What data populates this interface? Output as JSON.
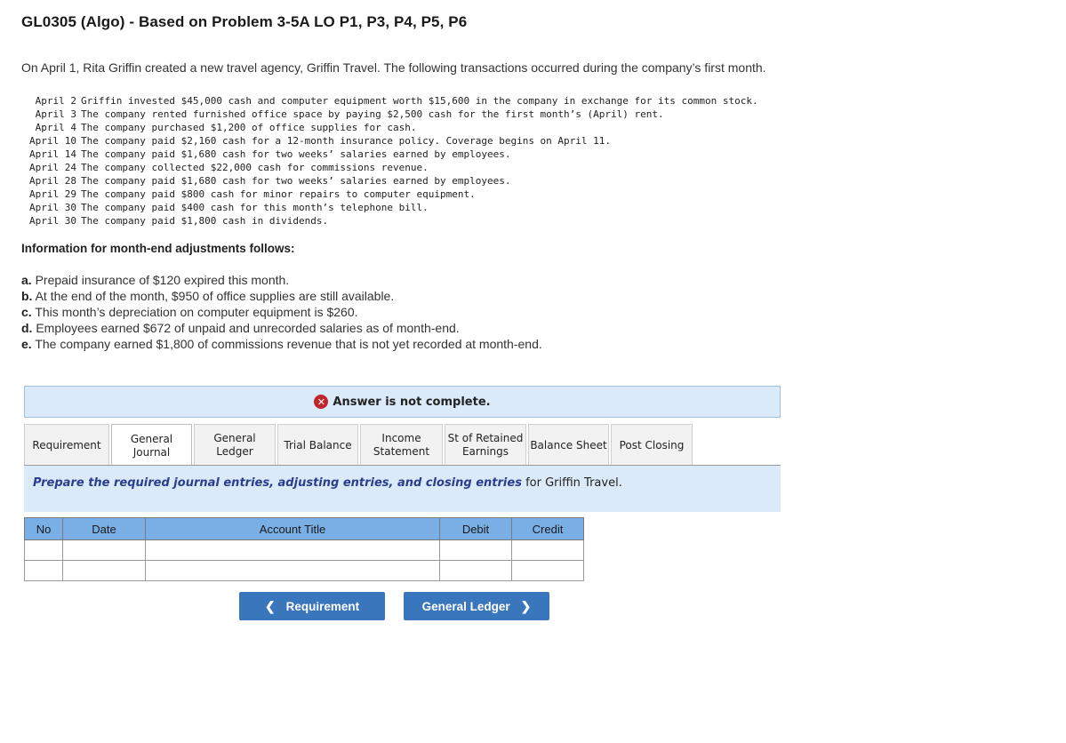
{
  "title": "GL0305 (Algo) - Based on Problem 3-5A LO P1, P3, P4, P5, P6",
  "intro": "On April 1, Rita Griffin created a new travel agency, Griffin Travel. The following transactions occurred during the company’s first month.",
  "transactions": [
    {
      "date": "April 2",
      "text": "Griffin invested $45,000 cash and computer equipment worth $15,600 in the company in exchange for its common stock."
    },
    {
      "date": "April 3",
      "text": "The company rented furnished office space by paying $2,500 cash for the first month’s (April) rent."
    },
    {
      "date": "April 4",
      "text": "The company purchased $1,200 of office supplies for cash."
    },
    {
      "date": "April 10",
      "text": "The company paid $2,160 cash for a 12-month insurance policy. Coverage begins on April 11."
    },
    {
      "date": "April 14",
      "text": "The company paid $1,680 cash for two weeks’ salaries earned by employees."
    },
    {
      "date": "April 24",
      "text": "The company collected $22,000 cash for commissions revenue."
    },
    {
      "date": "April 28",
      "text": "The company paid $1,680 cash for two weeks’ salaries earned by employees."
    },
    {
      "date": "April 29",
      "text": "The company paid $800 cash for minor repairs to computer equipment."
    },
    {
      "date": "April 30",
      "text": "The company paid $400 cash for this month’s telephone bill."
    },
    {
      "date": "April 30",
      "text": "The company paid $1,800 cash in dividends."
    }
  ],
  "adjustments_heading": "Information for month-end adjustments follows:",
  "adjustments": [
    {
      "letter": "a.",
      "text": " Prepaid insurance of $120 expired this month."
    },
    {
      "letter": "b.",
      "text": " At the end of the month, $950 of office supplies are still available."
    },
    {
      "letter": "c.",
      "text": " This month’s depreciation on computer equipment is $260."
    },
    {
      "letter": "d.",
      "text": " Employees earned $672 of unpaid and unrecorded salaries as of month-end."
    },
    {
      "letter": "e.",
      "text": " The company earned $1,800 of commissions revenue that is not yet recorded at month-end."
    }
  ],
  "answer_status": {
    "icon": "error-x-icon",
    "text": "Answer is not complete.",
    "color": "#c0262d"
  },
  "tabs": [
    {
      "label": "Requirement",
      "width": 96
    },
    {
      "label": "General\nJournal",
      "active": true
    },
    {
      "label": "General\nLedger"
    },
    {
      "label": "Trial Balance"
    },
    {
      "label": "Income\nStatement"
    },
    {
      "label": "St of Retained\nEarnings"
    },
    {
      "label": "Balance Sheet"
    },
    {
      "label": "Post Closing"
    }
  ],
  "instruction": {
    "emphasis": "Prepare the required journal entries, adjusting entries, and closing entries",
    "rest": " for Griffin Travel."
  },
  "journal_table": {
    "headers": [
      "No",
      "Date",
      "Account Title",
      "Debit",
      "Credit"
    ],
    "rows": [
      [
        "",
        "",
        "",
        "",
        ""
      ],
      [
        "",
        "",
        "",
        "",
        ""
      ]
    ]
  },
  "buttons": {
    "prev_label": "Requirement",
    "next_label": "General Ledger"
  },
  "colors": {
    "banner_bg": "#dbeaf8",
    "table_header": "#79afe5",
    "button": "#3a76bb",
    "instruction_emphasis": "#2a3d8f"
  }
}
